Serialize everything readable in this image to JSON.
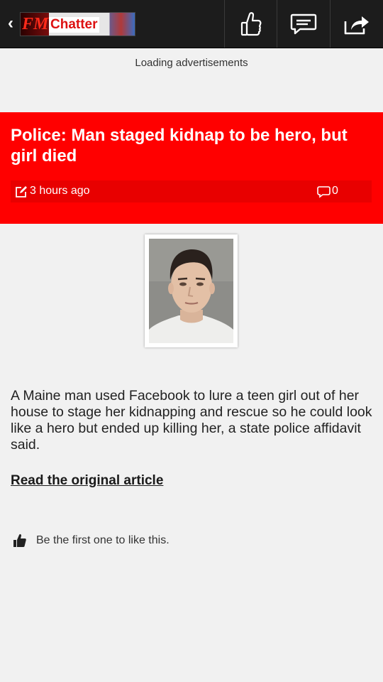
{
  "toolbar": {
    "back_icon": "chevron-left-icon",
    "logo_prefix": "FM",
    "logo_text": "Chatter",
    "buttons": [
      "thumbs-up-icon",
      "comment-icon",
      "share-icon"
    ]
  },
  "ad": {
    "text": "Loading advertisements"
  },
  "article": {
    "title": "Police: Man staged kidnap to be hero, but girl died",
    "time": "3 hours ago",
    "comment_count": "0",
    "body": "A Maine man used Facebook to lure a teen girl out of her house to stage her kidnapping and rescue so he could look like a hero but ended up killing her, a state police affidavit said.",
    "read_link": "Read the original article",
    "like_text": "Be the first one to like this."
  },
  "colors": {
    "header_bg": "#ff0000",
    "meta_bg": "#e80000",
    "topbar_bg": "#1c1c1c",
    "page_bg": "#f1f1f1"
  }
}
